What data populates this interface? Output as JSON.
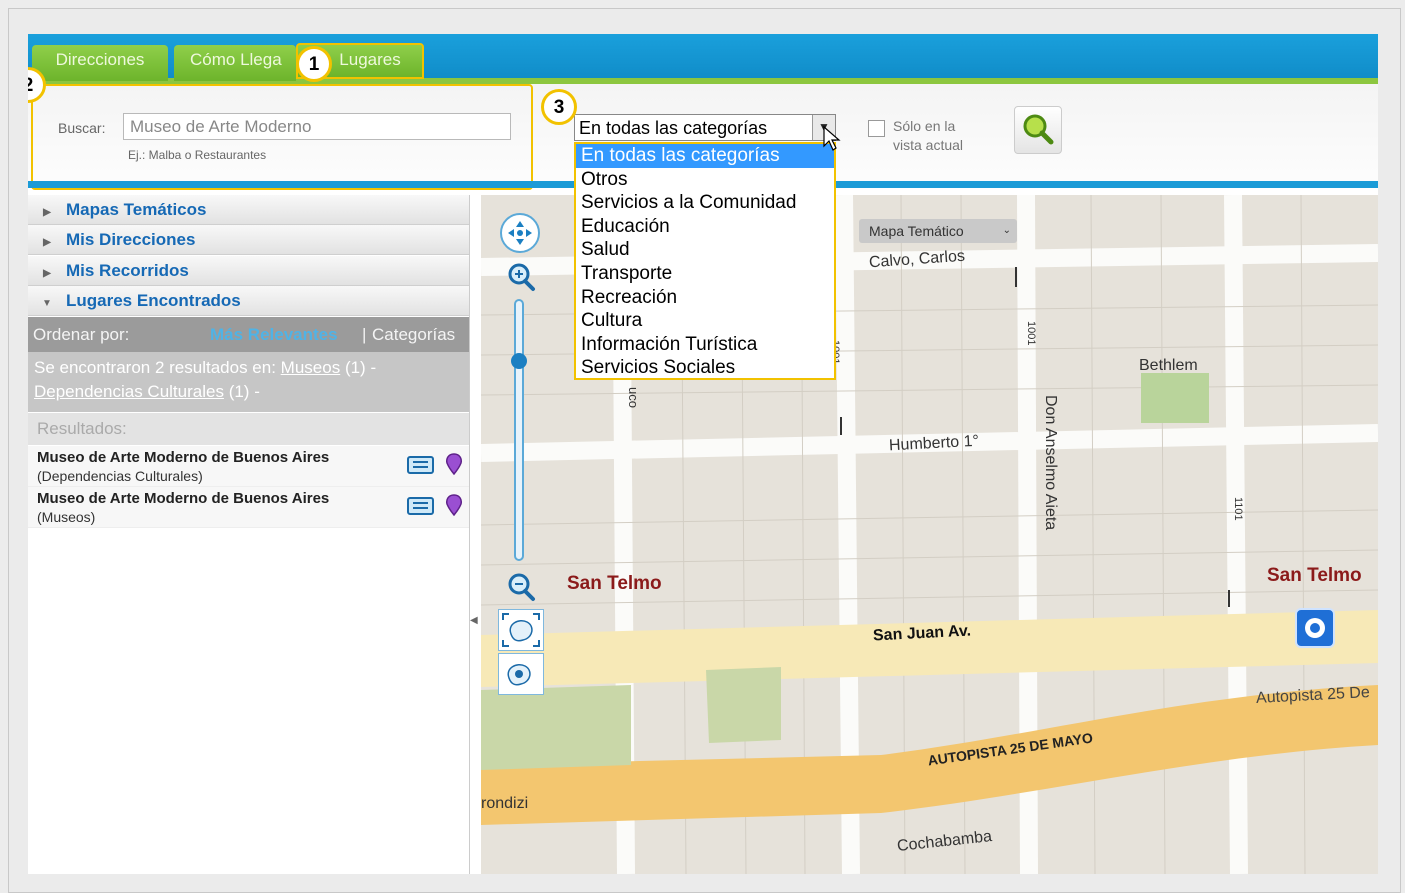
{
  "tabs": [
    "Direcciones",
    "Cómo Llega",
    "Lugares"
  ],
  "badges": [
    "1",
    "2",
    "3"
  ],
  "search": {
    "label": "Buscar:",
    "value": "Museo de Arte Moderno",
    "hint": "Ej.: Malba o Restaurantes"
  },
  "category_select": {
    "selected": "En todas las categorías",
    "options": [
      "En todas las categorías",
      "Otros",
      "Servicios a la Comunidad",
      "Educación",
      "Salud",
      "Transporte",
      "Recreación",
      "Cultura",
      "Información Turística",
      "Servicios Sociales"
    ]
  },
  "only_view": {
    "label_line1": "Sólo en la",
    "label_line2": "vista actual"
  },
  "accordion": [
    "Mapas Temáticos",
    "Mis Direcciones",
    "Mis Recorridos",
    "Lugares Encontrados"
  ],
  "order": {
    "label": "Ordenar por:",
    "relevant": "Más Relevantes",
    "separator": "|",
    "categories": "Categorías"
  },
  "found": {
    "prefix": "Se encontraron 2 resultados en:",
    "link1": "Museos",
    "count1": "(1) -",
    "link2": "Dependencias Culturales",
    "count2": "(1) -"
  },
  "results_label": "Resultados:",
  "results": [
    {
      "name": "Museo de Arte Moderno de Buenos Aires",
      "category": "(Dependencias Culturales)"
    },
    {
      "name": "Museo de Arte Moderno de Buenos Aires",
      "category": "(Museos)"
    }
  ],
  "map": {
    "thematic_select": "Mapa Temático",
    "streets": {
      "calvo": "Calvo, Carlos",
      "humberto": "Humberto 1°",
      "san_juan": "San Juan Av.",
      "autopista": "AUTOPISTA 25 DE MAYO",
      "autopista2": "Autopista 25 De",
      "cochabamba": "Cochabamba",
      "don_anselmo": "Don Anselmo Aieta",
      "rondizi": "rondizi",
      "n1001a": "1001",
      "n1001b": "1001",
      "n1101": "1101",
      "uco": "uco"
    },
    "bethlem": "Bethlem",
    "san_telmo_1": "San Telmo",
    "san_telmo_2": "San Telmo"
  },
  "colors": {
    "accent_yellow": "#f2c200",
    "tab_green": "#7cc13a",
    "bar_blue": "#1b9bd7",
    "link_blue": "#1669b5"
  }
}
